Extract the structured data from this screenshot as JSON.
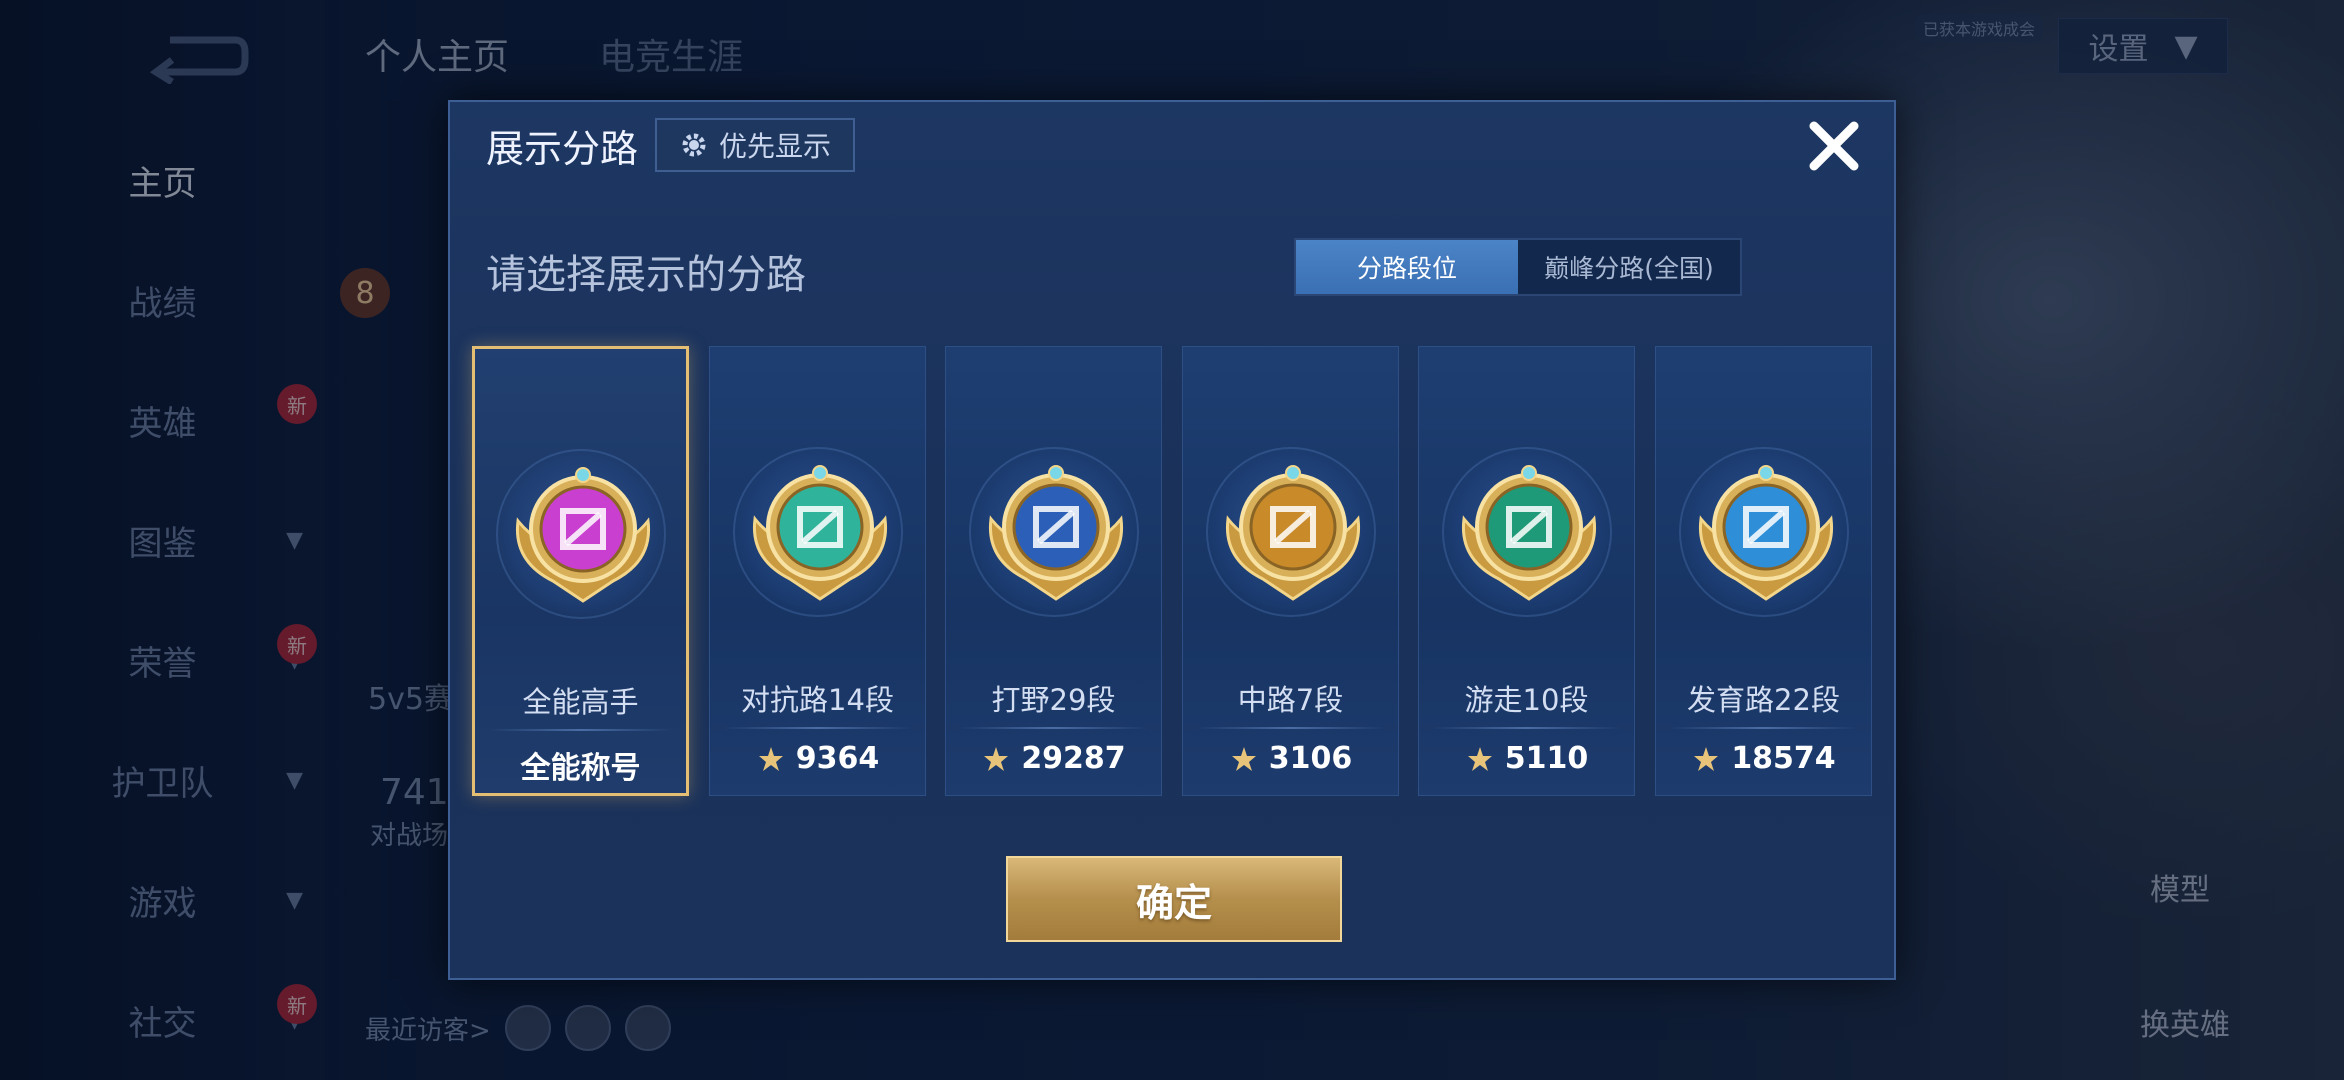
{
  "background": {
    "nav_items": [
      {
        "label": "主页",
        "active": true,
        "chevron": false,
        "new": false
      },
      {
        "label": "战绩",
        "active": false,
        "chevron": false,
        "new": false
      },
      {
        "label": "英雄",
        "active": false,
        "chevron": false,
        "new": true
      },
      {
        "label": "图鉴",
        "active": false,
        "chevron": true,
        "new": false
      },
      {
        "label": "荣誉",
        "active": false,
        "chevron": true,
        "new": true
      },
      {
        "label": "护卫队",
        "active": false,
        "chevron": true,
        "new": false
      },
      {
        "label": "游戏",
        "active": false,
        "chevron": true,
        "new": false
      },
      {
        "label": "社交",
        "active": false,
        "chevron": true,
        "new": true
      }
    ],
    "new_badge": "新",
    "top_tabs": [
      "个人主页",
      "电竞生涯"
    ],
    "settings_label": "设置",
    "auth_tag": "已获本游戏成会",
    "side_texts": {
      "level": "8",
      "mode": "5v5赛",
      "count": "741",
      "battle": "对战场"
    },
    "recent_visitors_label": "最近访客>",
    "right_tools": {
      "model": "模型",
      "swap_hero": "换英雄"
    }
  },
  "modal": {
    "title": "展示分路",
    "priority_label": "优先显示",
    "close_icon": "close-icon",
    "subtitle": "请选择展示的分路",
    "segments": [
      {
        "label": "分路段位",
        "active": true
      },
      {
        "label": "巅峰分路(全国)",
        "active": false
      }
    ],
    "cards": [
      {
        "name": "全能高手",
        "value": "全能称号",
        "selected": true,
        "show_value_icon": false,
        "badge_color": "#c93fcf",
        "badge_icon": "all-round-icon"
      },
      {
        "name": "对抗路14段",
        "value": "9364",
        "selected": false,
        "show_value_icon": true,
        "badge_color": "#2fb39a",
        "badge_icon": "clash-lane-icon"
      },
      {
        "name": "打野29段",
        "value": "29287",
        "selected": false,
        "show_value_icon": true,
        "badge_color": "#2b5fb8",
        "badge_icon": "jungle-icon"
      },
      {
        "name": "中路7段",
        "value": "3106",
        "selected": false,
        "show_value_icon": true,
        "badge_color": "#c98a2a",
        "badge_icon": "mid-lane-icon"
      },
      {
        "name": "游走10段",
        "value": "5110",
        "selected": false,
        "show_value_icon": true,
        "badge_color": "#1f9a78",
        "badge_icon": "roam-icon"
      },
      {
        "name": "发育路22段",
        "value": "18574",
        "selected": false,
        "show_value_icon": true,
        "badge_color": "#2e8fd8",
        "badge_icon": "farm-lane-icon"
      }
    ],
    "confirm_label": "确定"
  },
  "colors": {
    "gold": "#e3be73",
    "accent_blue": "#4c84c8"
  }
}
